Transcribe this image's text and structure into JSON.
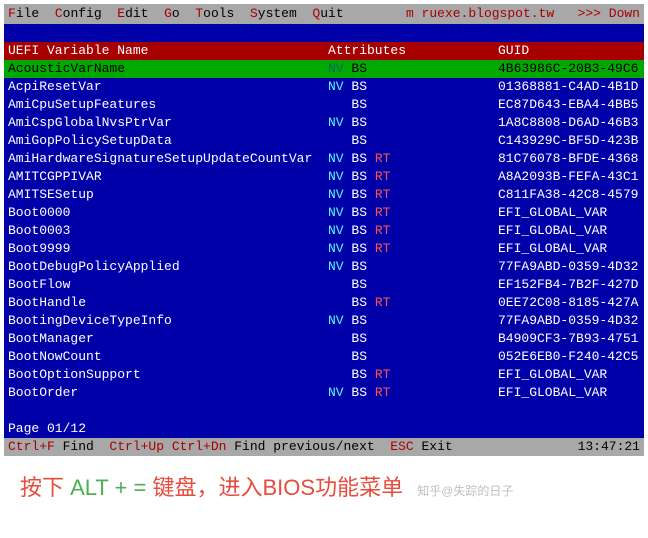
{
  "menubar": {
    "items": [
      {
        "hotkey": "F",
        "rest": "ile"
      },
      {
        "hotkey": "C",
        "rest": "onfig"
      },
      {
        "hotkey": "E",
        "rest": "dit"
      },
      {
        "hotkey": "G",
        "rest": "o"
      },
      {
        "hotkey": "T",
        "rest": "ools"
      },
      {
        "hotkey": "S",
        "rest": "ystem"
      },
      {
        "hotkey": "Q",
        "rest": "uit"
      }
    ],
    "blog": "m ruexe.blogspot.tw",
    "down": ">>> Down"
  },
  "header": {
    "col1": "UEFI Variable Name",
    "col2": "Attributes",
    "col3": "GUID"
  },
  "rows": [
    {
      "name": "AcousticVarName",
      "nv": true,
      "bs": true,
      "rt": false,
      "guid": "4B63986C-20B3-49C6",
      "selected": true
    },
    {
      "name": "AcpiResetVar",
      "nv": true,
      "bs": true,
      "rt": false,
      "guid": "01368881-C4AD-4B1D"
    },
    {
      "name": "AmiCpuSetupFeatures",
      "nv": false,
      "bs": true,
      "rt": false,
      "guid": "EC87D643-EBA4-4BB5"
    },
    {
      "name": "AmiCspGlobalNvsPtrVar",
      "nv": true,
      "bs": true,
      "rt": false,
      "guid": "1A8C8808-D6AD-46B3"
    },
    {
      "name": "AmiGopPolicySetupData",
      "nv": false,
      "bs": true,
      "rt": false,
      "guid": "C143929C-BF5D-423B"
    },
    {
      "name": "AmiHardwareSignatureSetupUpdateCountVar",
      "nv": true,
      "bs": true,
      "rt": true,
      "guid": "81C76078-BFDE-4368"
    },
    {
      "name": "AMITCGPPIVAR",
      "nv": true,
      "bs": true,
      "rt": true,
      "guid": "A8A2093B-FEFA-43C1"
    },
    {
      "name": "AMITSESetup",
      "nv": true,
      "bs": true,
      "rt": true,
      "guid": "C811FA38-42C8-4579"
    },
    {
      "name": "Boot0000",
      "nv": true,
      "bs": true,
      "rt": true,
      "guid": "EFI_GLOBAL_VAR"
    },
    {
      "name": "Boot0003",
      "nv": true,
      "bs": true,
      "rt": true,
      "guid": "EFI_GLOBAL_VAR"
    },
    {
      "name": "Boot9999",
      "nv": true,
      "bs": true,
      "rt": true,
      "guid": "EFI_GLOBAL_VAR"
    },
    {
      "name": "BootDebugPolicyApplied",
      "nv": true,
      "bs": true,
      "rt": false,
      "guid": "77FA9ABD-0359-4D32"
    },
    {
      "name": "BootFlow",
      "nv": false,
      "bs": true,
      "rt": false,
      "guid": "EF152FB4-7B2F-427D"
    },
    {
      "name": "BootHandle",
      "nv": false,
      "bs": true,
      "rt": true,
      "guid": "0EE72C08-8185-427A"
    },
    {
      "name": "BootingDeviceTypeInfo",
      "nv": true,
      "bs": true,
      "rt": false,
      "guid": "77FA9ABD-0359-4D32"
    },
    {
      "name": "BootManager",
      "nv": false,
      "bs": true,
      "rt": false,
      "guid": "B4909CF3-7B93-4751"
    },
    {
      "name": "BootNowCount",
      "nv": false,
      "bs": true,
      "rt": false,
      "guid": "052E6EB0-F240-42C5"
    },
    {
      "name": "BootOptionSupport",
      "nv": false,
      "bs": true,
      "rt": true,
      "guid": "EFI_GLOBAL_VAR"
    },
    {
      "name": "BootOrder",
      "nv": true,
      "bs": true,
      "rt": true,
      "guid": "EFI_GLOBAL_VAR"
    }
  ],
  "page": "Page 01/12",
  "statusbar": {
    "k1": "Ctrl+F",
    "t1": " Find  ",
    "k2": "Ctrl+Up Ctrl+Dn",
    "t2": " Find previous/next  ",
    "k3": "ESC",
    "t3": " Exit",
    "time": "13:47:21"
  },
  "caption": {
    "p1": "按下 ",
    "alt": "ALT + =",
    "p2": "  键盘，进入BIOS功能菜单",
    "watermark": "知乎@失踪的日子"
  }
}
